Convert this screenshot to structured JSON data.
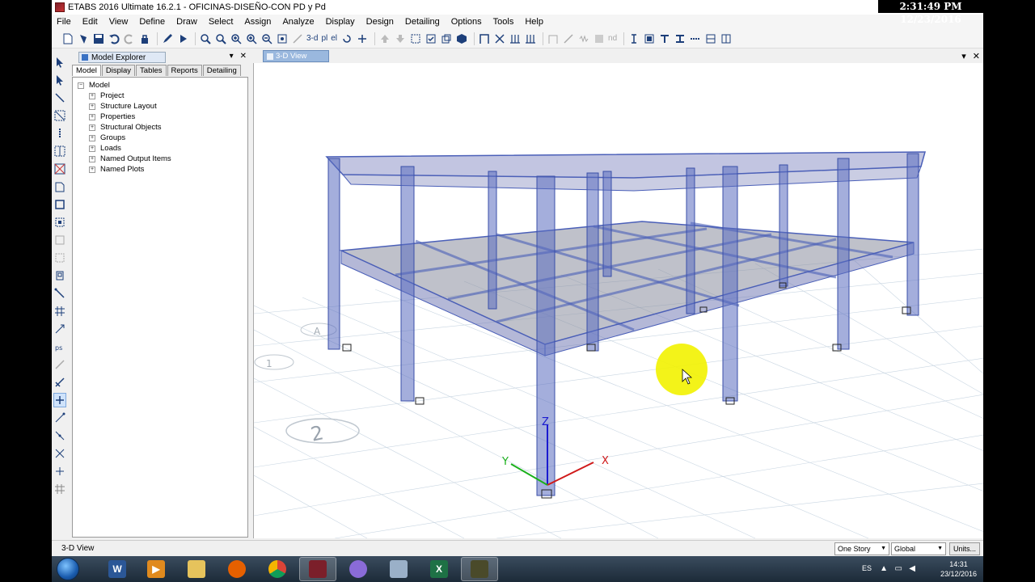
{
  "window": {
    "title": "ETABS 2016 Ultimate 16.2.1 - OFICINAS-DISEÑO-CON PD y Pd",
    "clock": "2:31:49 PM 12/23/2016"
  },
  "menu": [
    "File",
    "Edit",
    "View",
    "Define",
    "Draw",
    "Select",
    "Assign",
    "Analyze",
    "Display",
    "Design",
    "Detailing",
    "Options",
    "Tools",
    "Help"
  ],
  "toolbar": {
    "view_3d_label": "3-d",
    "plan_label": "pl",
    "elev_label": "el",
    "nd_label": "nd"
  },
  "explorer": {
    "title": "Model Explorer",
    "tabs": [
      "Model",
      "Display",
      "Tables",
      "Reports",
      "Detailing"
    ],
    "selected_tab": "Model",
    "root": "Model",
    "items": [
      "Project",
      "Structure Layout",
      "Properties",
      "Structural Objects",
      "Groups",
      "Loads",
      "Named Output Items",
      "Named Plots"
    ]
  },
  "view": {
    "tab_label": "3-D View",
    "axis_x": "X",
    "axis_y": "Y",
    "axis_z": "Z",
    "grid_label_1": "2",
    "grid_label_2": "A",
    "grid_label_3": "1",
    "colors": {
      "frame": "#4a5fb8",
      "slab": "#8f93a8",
      "cursor_highlight": "#f2f200"
    }
  },
  "status": {
    "text": "3-D View",
    "story_select": "One Story",
    "coord_select": "Global",
    "units_button": "Units..."
  },
  "taskbar": {
    "lang": "ES",
    "time": "14:31",
    "date": "23/12/2016",
    "apps": [
      "word-icon",
      "media-icon",
      "folder-icon",
      "firefox-icon",
      "chrome-icon",
      "etabs-icon",
      "app-icon",
      "calculator-icon",
      "excel-icon",
      "app2-icon"
    ]
  }
}
